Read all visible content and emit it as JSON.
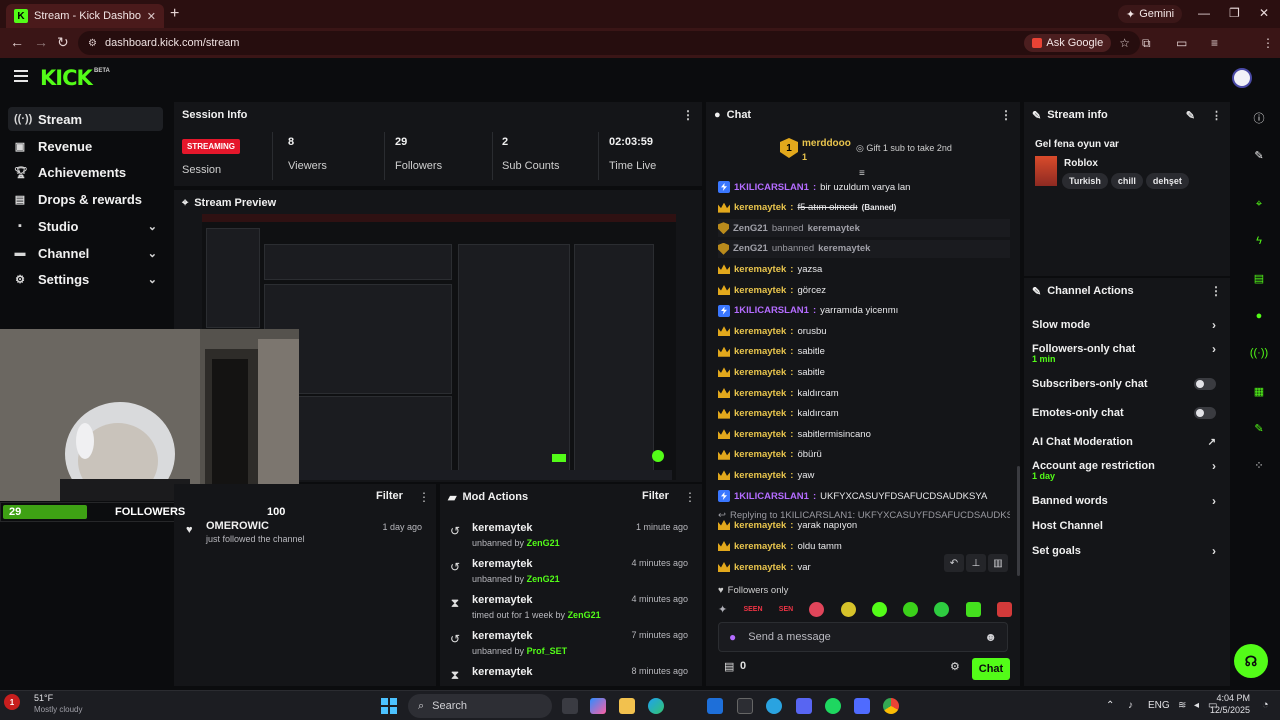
{
  "browser": {
    "tab_title": "Stream - Kick Dashboard",
    "url": "dashboard.kick.com/stream",
    "gemini_label": "Gemini",
    "ask_google_label": "Ask Google"
  },
  "header": {
    "logo": "KICK",
    "beta": "BETA"
  },
  "sidebar": {
    "items": [
      {
        "label": "Stream",
        "icon": "stream-icon"
      },
      {
        "label": "Revenue",
        "icon": "revenue-icon"
      },
      {
        "label": "Achievements",
        "icon": "trophy-icon"
      },
      {
        "label": "Drops & rewards",
        "icon": "gift-icon"
      },
      {
        "label": "Studio",
        "icon": "studio-icon"
      },
      {
        "label": "Channel",
        "icon": "channel-icon"
      },
      {
        "label": "Settings",
        "icon": "gear-icon"
      }
    ]
  },
  "session": {
    "title": "Session Info",
    "status": "STREAMING",
    "status_label": "Session",
    "stats": [
      {
        "value": "8",
        "label": "Viewers"
      },
      {
        "value": "29",
        "label": "Followers"
      },
      {
        "value": "2",
        "label": "Sub Counts"
      },
      {
        "value": "02:03:59",
        "label": "Time Live"
      }
    ]
  },
  "preview": {
    "title": "Stream Preview"
  },
  "followers_overlay": {
    "current": "29",
    "label": "FOLLOWERS",
    "goal": "100",
    "progress": 0.29
  },
  "activity": {
    "filter": "Filter",
    "rows": [
      {
        "name": "OMEROWIC",
        "sub": "just followed the channel",
        "time": "1 day ago"
      }
    ]
  },
  "mod_actions": {
    "title": "Mod Actions",
    "filter": "Filter",
    "rows": [
      {
        "name": "keremaytek",
        "action": "unbanned by",
        "actor": "ZenG21",
        "time": "1 minute ago",
        "icon": "undo-icon"
      },
      {
        "name": "keremaytek",
        "action": "unbanned by",
        "actor": "ZenG21",
        "time": "4 minutes ago",
        "icon": "undo-icon"
      },
      {
        "name": "keremaytek",
        "action": "timed out for 1 week by",
        "actor": "ZenG21",
        "time": "4 minutes ago",
        "icon": "hourglass-icon"
      },
      {
        "name": "keremaytek",
        "action": "unbanned by",
        "actor": "Prof_SET",
        "time": "7 minutes ago",
        "icon": "undo-icon"
      },
      {
        "name": "keremaytek",
        "action": "",
        "actor": "",
        "time": "8 minutes ago",
        "icon": "hourglass-icon"
      }
    ]
  },
  "chat": {
    "title": "Chat",
    "pinned_user": "merddooo",
    "pinned_count": "1",
    "gift_text": "Gift 1 sub to take 2nd",
    "lines": [
      {
        "user": "1KILICARSLAN1",
        "text": "bir uzuldum varya lan",
        "role": "p"
      },
      {
        "user": "keremaytek",
        "text": "f5 atım olmedı",
        "role": "y",
        "banned": "(Banned)",
        "strike": true
      },
      {
        "user": "ZenG21",
        "text": "banned",
        "target": "keremaytek",
        "role": "sys"
      },
      {
        "user": "ZenG21",
        "text": "unbanned",
        "target": "keremaytek",
        "role": "sys"
      },
      {
        "user": "keremaytek",
        "text": "yazsa",
        "role": "y"
      },
      {
        "user": "keremaytek",
        "text": "görcez",
        "role": "y"
      },
      {
        "user": "1KILICARSLAN1",
        "text": "yarramıda yicenmı",
        "role": "p"
      },
      {
        "user": "keremaytek",
        "text": "orusbu",
        "role": "y"
      },
      {
        "user": "keremaytek",
        "text": "sabitle",
        "role": "y"
      },
      {
        "user": "keremaytek",
        "text": "sabitle",
        "role": "y"
      },
      {
        "user": "keremaytek",
        "text": "kaldırcam",
        "role": "y"
      },
      {
        "user": "keremaytek",
        "text": "kaldırcam",
        "role": "y"
      },
      {
        "user": "keremaytek",
        "text": "sabitlermisincano",
        "role": "y"
      },
      {
        "user": "keremaytek",
        "text": "öbürü",
        "role": "y"
      },
      {
        "user": "keremaytek",
        "text": "yaw",
        "role": "y"
      },
      {
        "user": "1KILICARSLAN1",
        "text": "UKFYXCASUYFDSAFUCDSAUDKSYA",
        "role": "p"
      }
    ],
    "reply_hint": "Replying to 1KILICARSLAN1: UKFYXCASUYFDSAFUCDSAUDKSYA",
    "lines_after": [
      {
        "user": "keremaytek",
        "text": "yarak napıyon"
      },
      {
        "user": "keremaytek",
        "text": "oldu tamm"
      },
      {
        "user": "keremaytek",
        "text": "var"
      }
    ],
    "followers_only": "Followers only",
    "emote_text_1": "SEEN",
    "emote_text_2": "SEN",
    "placeholder": "Send a message",
    "points": "0",
    "send_label": "Chat"
  },
  "stream_info": {
    "title": "Stream info",
    "stream_title": "Gel fena oyun var",
    "category": "Roblox",
    "tags": [
      "Turkish",
      "chill",
      "dehşet"
    ]
  },
  "channel_actions": {
    "title": "Channel Actions",
    "items": [
      {
        "label": "Slow mode",
        "control": "chevron"
      },
      {
        "label": "Followers-only chat",
        "sub": "1 min",
        "control": "chevron"
      },
      {
        "label": "Subscribers-only chat",
        "control": "toggle"
      },
      {
        "label": "Emotes-only chat",
        "control": "toggle"
      },
      {
        "label": "AI Chat Moderation",
        "control": "external"
      },
      {
        "label": "Account age restriction",
        "sub": "1 day",
        "control": "chevron"
      },
      {
        "label": "Banned words",
        "control": "chevron"
      },
      {
        "label": "Host Channel",
        "control": "none"
      },
      {
        "label": "Set goals",
        "control": "chevron"
      }
    ]
  },
  "taskbar": {
    "weather_temp": "51°F",
    "weather_sub": "Mostly cloudy",
    "search_label": "Search",
    "lang": "ENG",
    "time": "4:04 PM",
    "date": "12/5/2025",
    "notif_count": "1"
  },
  "colors": {
    "kick_green": "#53fc18",
    "live_red": "#e5172b",
    "panel": "#141518",
    "bg": "#0b0c0e"
  }
}
